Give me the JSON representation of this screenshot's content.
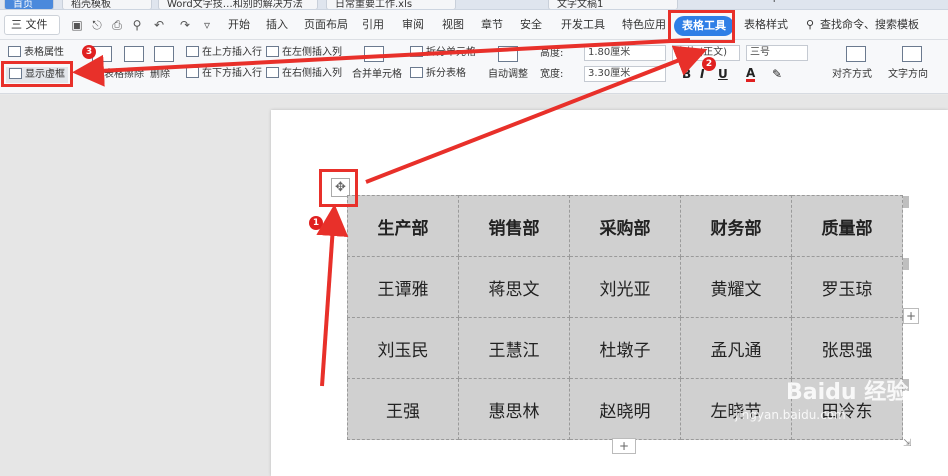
{
  "tabs": [
    "首页",
    "稻壳模板",
    "Word文字技…和别的解决方法",
    "日常重要工作.xls",
    "文字文稿1",
    "+"
  ],
  "menu": {
    "file": "三 文件",
    "items": [
      "开始",
      "插入",
      "页面布局",
      "引用",
      "审阅",
      "视图",
      "章节",
      "安全",
      "开发工具",
      "特色应用",
      "表格工具",
      "表格样式"
    ],
    "search": "查找命令、搜索模板"
  },
  "ribbon": {
    "table_props": "表格属性",
    "show_gridlines": "显示虚框",
    "draw": "绘制表格",
    "erase": "擦除",
    "delete": "删除",
    "insert_above": "在上方插入行",
    "insert_below": "在下方插入行",
    "insert_left": "在左侧插入列",
    "insert_right": "在右侧插入列",
    "merge": "合并单元格",
    "split_cells": "拆分单元格",
    "split_table": "拆分表格",
    "autofit": "自动调整",
    "height_label": "高度:",
    "height_value": "1.80厘米",
    "width_label": "宽度:",
    "width_value": "3.30厘米",
    "font_name": "宋体 (正文)",
    "font_size": "三号",
    "align": "对齐方式",
    "text_dir": "文字方向"
  },
  "table": {
    "rows": [
      [
        "生产部",
        "销售部",
        "采购部",
        "财务部",
        "质量部"
      ],
      [
        "王谭雅",
        "蒋思文",
        "刘光亚",
        "黄耀文",
        "罗玉琼"
      ],
      [
        "刘玉民",
        "王慧江",
        "杜墩子",
        "孟凡通",
        "张思强"
      ],
      [
        "王强",
        "惠思林",
        "赵晓明",
        "左晓节",
        "田冷东"
      ]
    ]
  },
  "callouts": [
    "1",
    "2",
    "3"
  ],
  "watermark": {
    "main": "Baidu 经验",
    "sub": "jingyan.baidu.com"
  },
  "colors": {
    "accent": "#2f7fe6",
    "annotation": "#e8302a"
  }
}
